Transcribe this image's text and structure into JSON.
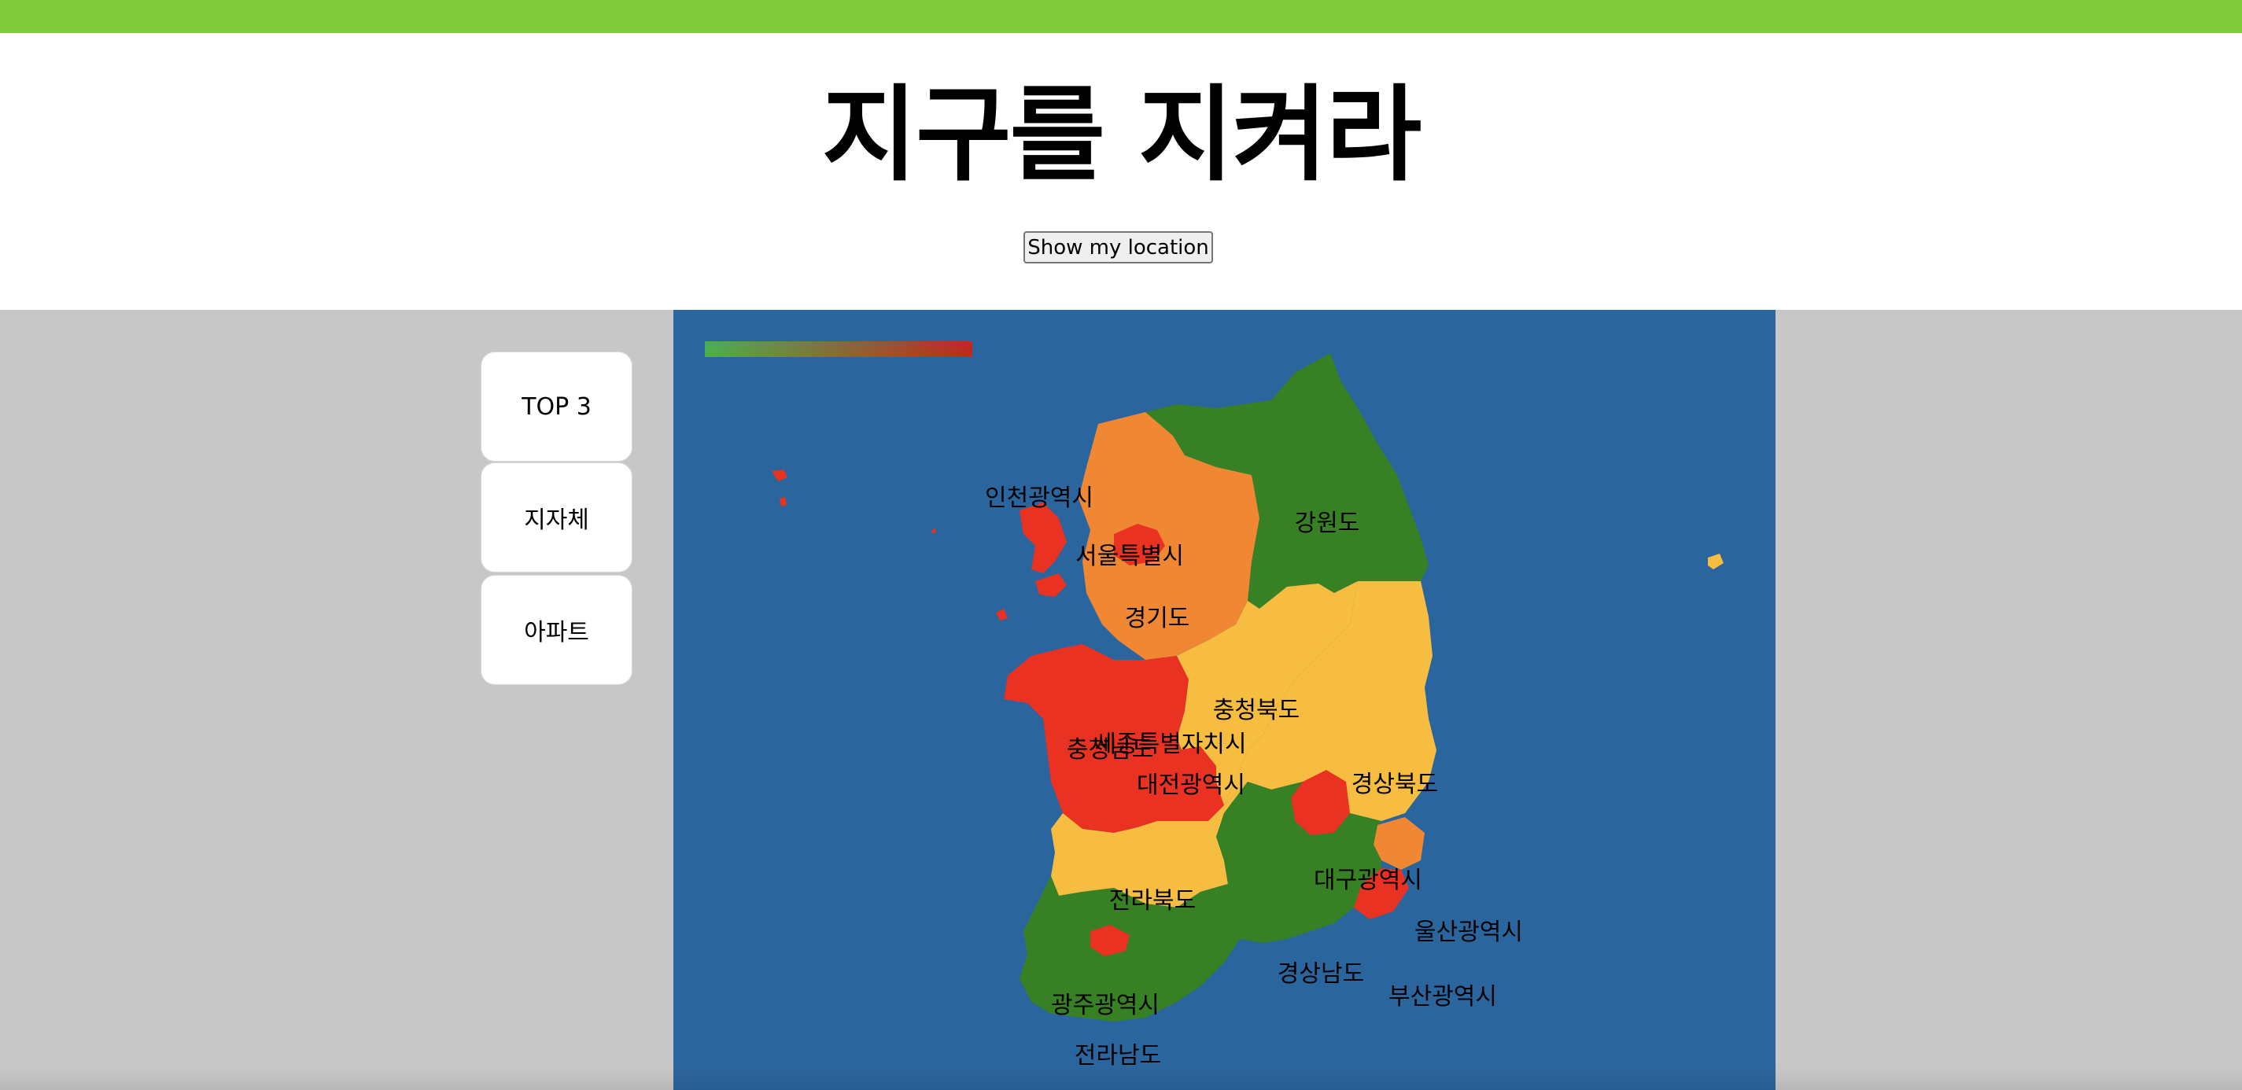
{
  "colors": {
    "topbar": "#7fcb3b",
    "sea": "#2b659d",
    "low": "#378023",
    "mid": "#f6bd40",
    "high": "#f08833",
    "critical": "#e93222",
    "legend_start": "#4caf50",
    "legend_end": "#c0281e"
  },
  "header": {
    "title": "지구를 지켜라",
    "location_button": "Show my location"
  },
  "sidebar": {
    "items": [
      {
        "label": "TOP 3"
      },
      {
        "label": "지자체"
      },
      {
        "label": "아파트"
      }
    ]
  },
  "map": {
    "legend": {
      "from": "low",
      "to": "critical"
    },
    "regions": [
      {
        "name": "인천광역시",
        "level": "critical"
      },
      {
        "name": "서울특별시",
        "level": "critical"
      },
      {
        "name": "경기도",
        "level": "high"
      },
      {
        "name": "강원도",
        "level": "low"
      },
      {
        "name": "충청북도",
        "level": "mid"
      },
      {
        "name": "세종특별자치시",
        "level": "critical"
      },
      {
        "name": "충청남도",
        "level": "critical"
      },
      {
        "name": "대전광역시",
        "level": "critical"
      },
      {
        "name": "경상북도",
        "level": "mid"
      },
      {
        "name": "대구광역시",
        "level": "critical"
      },
      {
        "name": "전라북도",
        "level": "mid"
      },
      {
        "name": "울산광역시",
        "level": "high"
      },
      {
        "name": "경상남도",
        "level": "low"
      },
      {
        "name": "부산광역시",
        "level": "critical"
      },
      {
        "name": "광주광역시",
        "level": "critical"
      },
      {
        "name": "전라남도",
        "level": "low"
      }
    ]
  }
}
